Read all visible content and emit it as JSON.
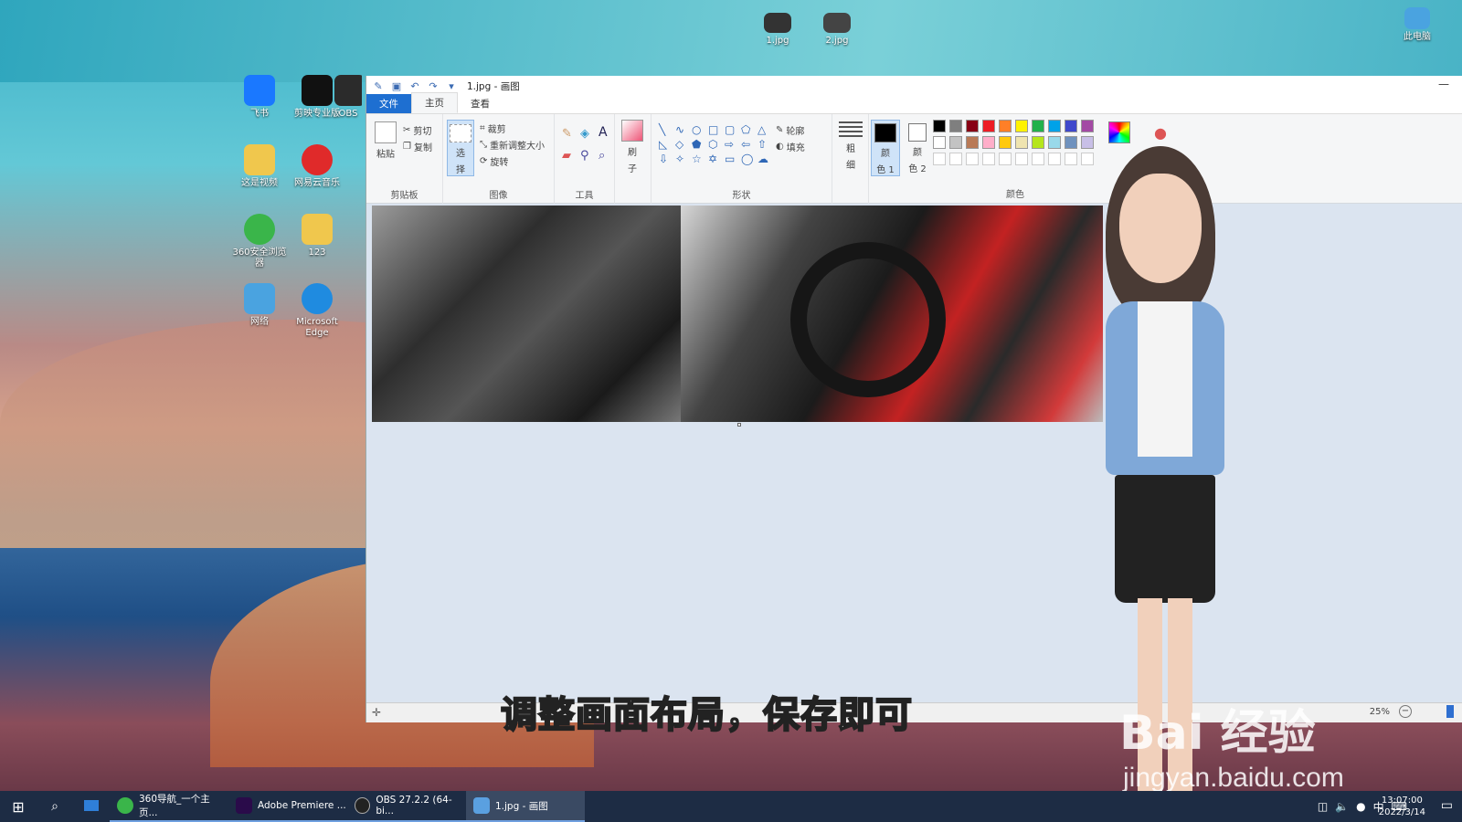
{
  "desktop": {
    "top_icons": [
      {
        "label": "1.jpg"
      },
      {
        "label": "2.jpg"
      },
      {
        "label": "此电脑"
      }
    ],
    "icons": [
      {
        "label": "飞书",
        "color": "#1a78ff"
      },
      {
        "label": "剪映专业版",
        "color": "#111111"
      },
      {
        "label": "OBS",
        "color": "#2b2b2b"
      },
      {
        "label": "这是视频",
        "color": "#f0c74d"
      },
      {
        "label": "网易云音乐",
        "color": "#e02a2a"
      },
      {
        "label": "360安全浏览器",
        "color": "#3ab54a"
      },
      {
        "label": "123",
        "color": "#f0c74d"
      },
      {
        "label": "网络",
        "color": "#4aa3e0"
      },
      {
        "label": "Microsoft Edge",
        "color": "#1f8be0"
      }
    ]
  },
  "paint": {
    "title": "1.jpg - 画图",
    "tabs": {
      "file": "文件",
      "home": "主页",
      "view": "查看"
    },
    "clipboard": {
      "paste": "粘贴",
      "cut": "剪切",
      "copy": "复制",
      "group": "剪贴板"
    },
    "image": {
      "select_top": "选",
      "select_bottom": "择",
      "crop": "裁剪",
      "resize": "重新调整大小",
      "rotate": "旋转",
      "group": "图像"
    },
    "tools": {
      "group": "工具"
    },
    "brushes": {
      "label_top": "刷",
      "label_bottom": "子"
    },
    "shapes": {
      "outline": "轮廓",
      "fill": "填充",
      "group": "形状"
    },
    "size": {
      "top": "粗",
      "bottom": "细"
    },
    "color1": {
      "top": "颜",
      "bottom": "色 1"
    },
    "color2": {
      "top": "颜",
      "bottom": "色 2"
    },
    "colors_group": "颜色",
    "palette_row1": [
      "#000000",
      "#7f7f7f",
      "#880015",
      "#ed1c24",
      "#ff7f27",
      "#fff200",
      "#22b14c",
      "#00a2e8",
      "#3f48cc",
      "#a349a4"
    ],
    "palette_row2": [
      "#ffffff",
      "#c3c3c3",
      "#b97a57",
      "#ffaec9",
      "#ffc90e",
      "#efe4b0",
      "#b5e61d",
      "#99d9ea",
      "#7092be",
      "#c8bfe7"
    ],
    "zoom": "25%"
  },
  "caption": "调整画面布局，保存即可",
  "watermark": {
    "logo": "Bai 经验",
    "url": "jingyan.baidu.com"
  },
  "taskbar": {
    "items": [
      {
        "label": "360导航_一个主页...",
        "color": "#3ab54a"
      },
      {
        "label": "Adobe Premiere ...",
        "color": "#2a0b4a"
      },
      {
        "label": "OBS 27.2.2 (64-bi...",
        "color": "#222222"
      },
      {
        "label": "1.jpg - 画图",
        "color": "#5aa0e0"
      }
    ],
    "ime": "中",
    "time": "13:07:00",
    "date": "2022/3/14"
  }
}
